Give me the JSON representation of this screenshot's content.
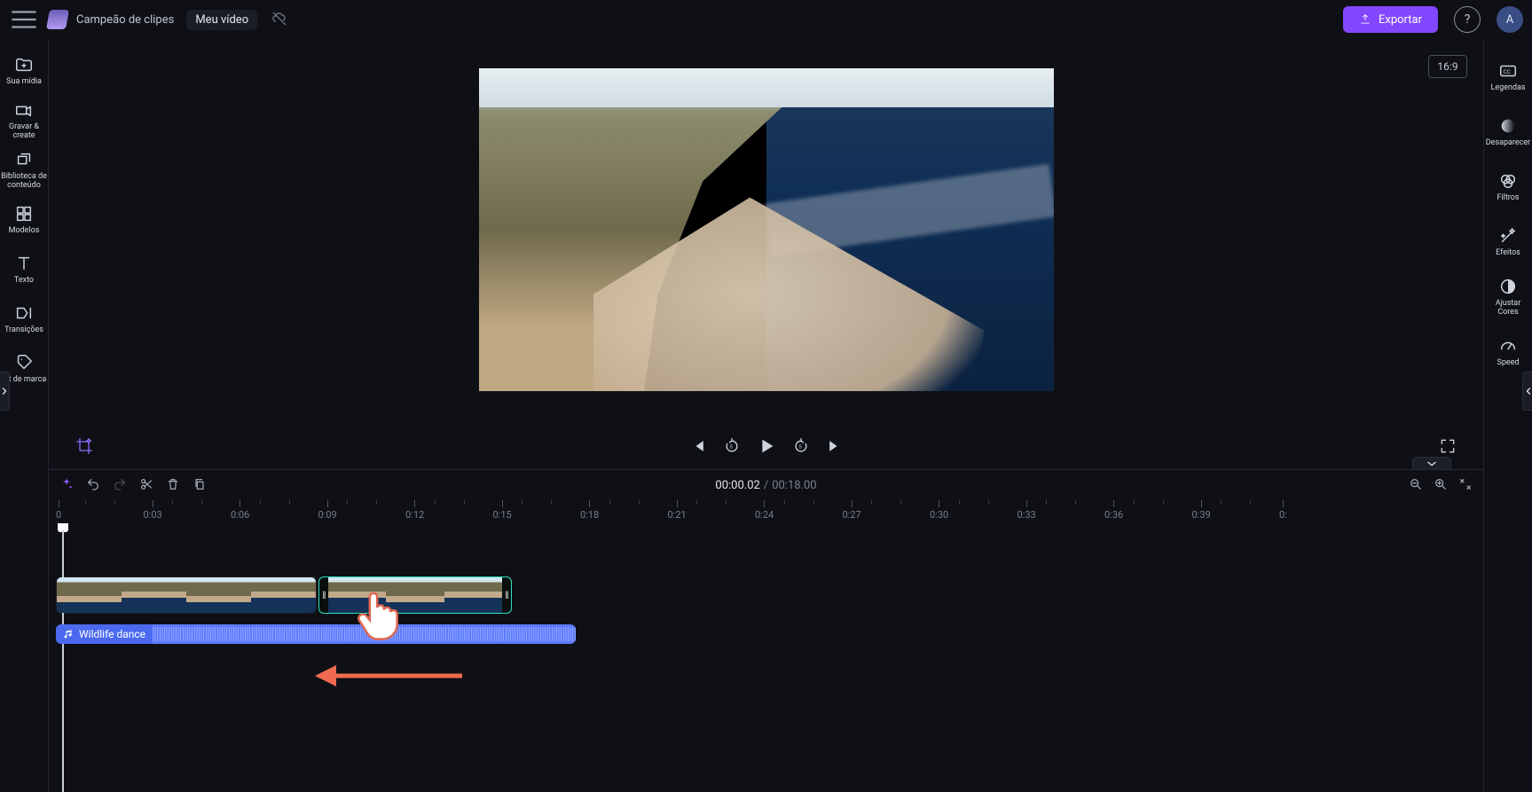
{
  "header": {
    "app_name": "Campeão de clipes",
    "project_name": "Meu vídeo",
    "export_label": "Exportar",
    "avatar_initial": "A"
  },
  "left_rail": [
    {
      "key": "media",
      "label": "Sua mídia"
    },
    {
      "key": "record",
      "label": "Gravar &amp; create"
    },
    {
      "key": "library",
      "label": "Biblioteca de conteúdo"
    },
    {
      "key": "templates",
      "label": "Modelos"
    },
    {
      "key": "text",
      "label": "Texto"
    },
    {
      "key": "transitions",
      "label": "Transições"
    },
    {
      "key": "brand",
      "label": "Kit de marca"
    }
  ],
  "right_rail": [
    {
      "key": "captions",
      "label": "Legendas"
    },
    {
      "key": "fade",
      "label": "Desaparecer"
    },
    {
      "key": "filters",
      "label": "Filtros"
    },
    {
      "key": "effects",
      "label": "Efeitos"
    },
    {
      "key": "colors",
      "label": "Ajustar Cores"
    },
    {
      "key": "speed",
      "label": "Speed"
    }
  ],
  "stage": {
    "aspect_ratio": "16:9"
  },
  "playback": {
    "current_time": "00:00.02",
    "separator": "/",
    "duration": "00:18.00"
  },
  "ruler": {
    "ticks": [
      "0",
      "0:03",
      "0:06",
      "0:09",
      "0:12",
      "0:15",
      "0:18",
      "0:21",
      "0:24",
      "0:27",
      "0:30",
      "0:33",
      "0:36",
      "0:39",
      "0:"
    ]
  },
  "audio_clip": {
    "label": "Wildlife dance"
  }
}
